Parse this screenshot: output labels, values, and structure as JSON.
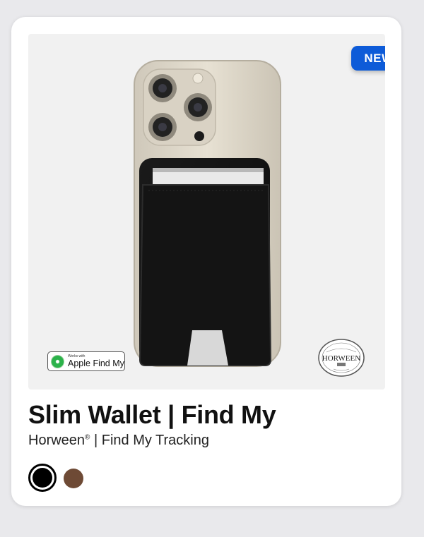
{
  "badge": {
    "label": "NEW",
    "color": "#0d5bd8"
  },
  "product": {
    "title": "Slim Wallet | Find My",
    "subtitle_brand": "Horween",
    "subtitle_mark": "®",
    "subtitle_rest": " | Find My Tracking"
  },
  "findmy": {
    "small_text": "Works with",
    "label": "Apple Find My",
    "icon": "find-my-icon"
  },
  "horween_logo": {
    "text": "HORWEEN",
    "icon": "horween-leather-logo"
  },
  "swatches": [
    {
      "name": "Black",
      "color": "#000000",
      "selected": true
    },
    {
      "name": "Brown",
      "color": "#6e4a35",
      "selected": false
    }
  ]
}
